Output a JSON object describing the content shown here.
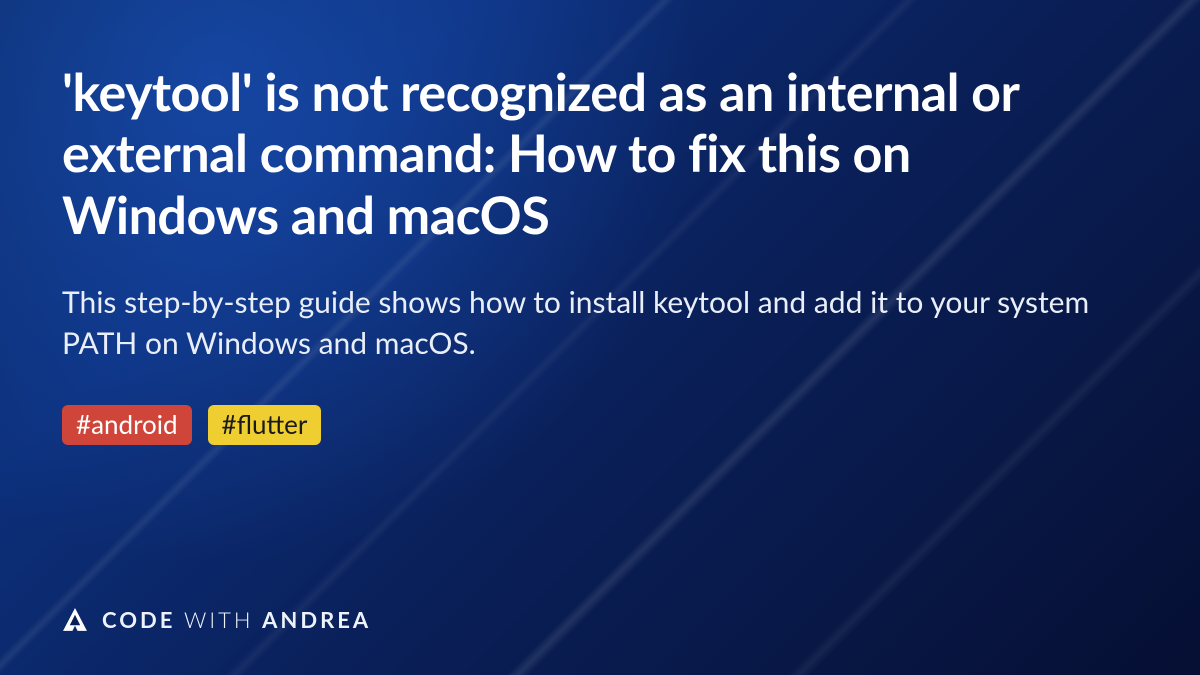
{
  "article": {
    "title": "'keytool' is not recognized as an internal or external command: How to fix this on Windows and macOS",
    "subtitle": "This step-by-step guide shows how to install keytool and add it to your system PATH on Windows and macOS.",
    "tags": [
      {
        "label": "#android",
        "style": "red"
      },
      {
        "label": "#flutter",
        "style": "yellow"
      }
    ]
  },
  "brand": {
    "word1": "CODE",
    "word2": "WITH",
    "word3": "ANDREA"
  },
  "colors": {
    "tag_red_bg": "#d0453a",
    "tag_yellow_bg": "#efce31",
    "background_primary": "#0a2a66"
  }
}
